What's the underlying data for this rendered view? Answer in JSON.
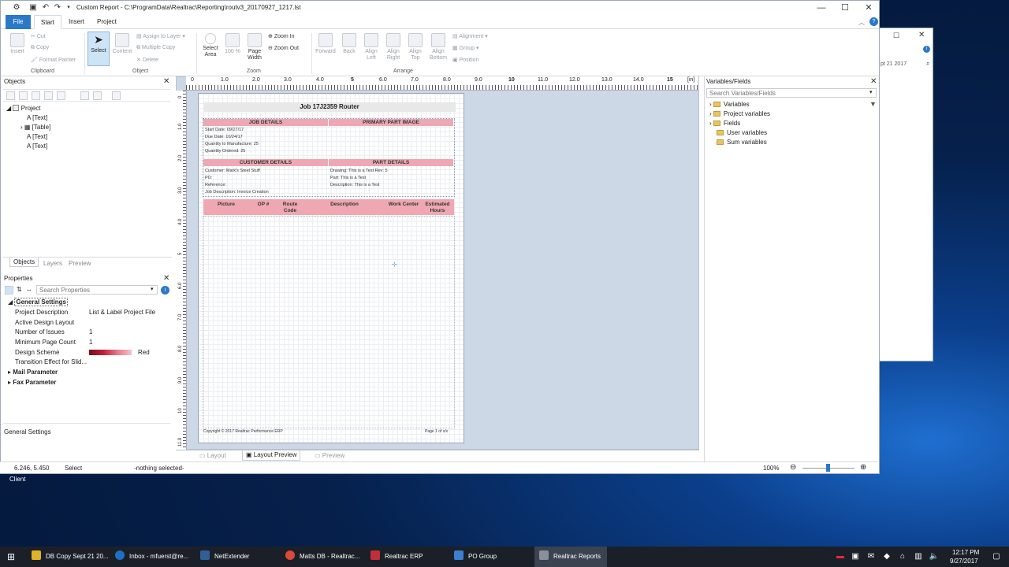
{
  "window": {
    "title": "Custom Report - C:\\ProgramData\\Realtrac\\Reporting\\routv3_20170927_1217.lst"
  },
  "tabs": [
    "File",
    "Start",
    "Insert",
    "Project"
  ],
  "ribbon": {
    "clipboard": {
      "insert": "Insert",
      "cut": "Cut",
      "copy": "Copy",
      "format_painter": "Format Painter",
      "label": "Clipboard"
    },
    "object": {
      "select": "Select",
      "content": "Content",
      "assign_layer": "Assign to Layer",
      "multiple_copy": "Multiple Copy",
      "delete": "Delete",
      "label": "Object"
    },
    "zoom": {
      "select_area": "Select Area",
      "hundred": "100 %",
      "page_width": "Page Width",
      "zoom_in": "Zoom In",
      "zoom_out": "Zoom Out",
      "label": "Zoom"
    },
    "arrange": {
      "forward": "Forward",
      "back": "Back",
      "align_left": "Align Left",
      "align_right": "Align Right",
      "align_top": "Align Top",
      "align_bottom": "Align Bottom",
      "alignment": "Alignment",
      "group": "Group",
      "position": "Position",
      "label": "Arrange"
    }
  },
  "objects_panel": {
    "title": "Objects",
    "tree": [
      "Project",
      "[Text]",
      "[Table]",
      "[Text]",
      "[Text]"
    ],
    "tabs": [
      "Objects",
      "Layers",
      "Preview"
    ]
  },
  "properties_panel": {
    "title": "Properties",
    "search_placeholder": "Search Properties",
    "general": "General Settings",
    "rows": [
      {
        "name": "Project Description",
        "value": "List & Label Project File"
      },
      {
        "name": "Active Design Layout",
        "value": ""
      },
      {
        "name": "Number of Issues",
        "value": "1"
      },
      {
        "name": "Minimum Page Count",
        "value": "1"
      },
      {
        "name": "Design Scheme",
        "value": "Red"
      },
      {
        "name": "Transition Effect for Slid...",
        "value": ""
      }
    ],
    "mail": "Mail Parameter",
    "fax": "Fax Parameter",
    "footer": "General Settings"
  },
  "ruler": {
    "top": [
      "0",
      "1.0",
      "2.0",
      "3.0",
      "4.0",
      "5",
      "6.0",
      "7.0",
      "8.0",
      "9.0",
      "10",
      "11.0",
      "12.0",
      "13.0",
      "14.0",
      "15",
      "[in]"
    ],
    "left": [
      "0",
      "1.0",
      "2.0",
      "3.0",
      "4.0",
      "5",
      "6.0",
      "7.0",
      "8.0",
      "9.0",
      "10",
      "11.0"
    ]
  },
  "report": {
    "title": "Job 17J2359 Router",
    "job_details": "JOB DETAILS",
    "primary_part_image": "PRIMARY PART IMAGE",
    "start_date": "Start Date: 09/27/17",
    "due_date": "Due Date: 10/24/17",
    "qty_manufacture": "Quantity to Manufacture: 25",
    "qty_ordered": "Quantity Ordered: 25",
    "customer_details": "CUSTOMER DETAILS",
    "part_details": "PART DETAILS",
    "customer": "Customer: Mark's Steel Stuff",
    "po": "PO:",
    "reference": "Reference:",
    "job_description": "Job Description: Invoice Creation",
    "drawing": "Drawing: This is a Test Rev: 5",
    "part": "Part: This is a Test",
    "description": "Description: This is a Test",
    "columns": [
      "Picture",
      "OP #",
      "Route Code",
      "Description",
      "Work Center",
      "Estimated Hours"
    ],
    "footer_left": "Copyright © 2017 Realtrac Performance ERP",
    "footer_right": "Page 1 of x/x"
  },
  "view_tabs": [
    "Layout",
    "Layout Preview",
    "Preview"
  ],
  "variables_panel": {
    "title": "Variables/Fields",
    "search_placeholder": "Search Variables/Fields",
    "items": [
      "Variables",
      "Project variables",
      "Fields",
      "User variables",
      "Sum variables"
    ]
  },
  "status": {
    "coords": "6.246, 5.450",
    "mode": "Select",
    "selection": "-nothing selected-",
    "zoom": "100%"
  },
  "client_label": "Client",
  "taskbar": {
    "items": [
      "DB Copy Sept 21 20...",
      "Inbox - mfuerst@re...",
      "NetExtender",
      "Matts DB - Realtrac...",
      "Realtrac ERP",
      "PO Group",
      "Realtrac Reports"
    ],
    "time": "12:17 PM",
    "date": "9/27/2017"
  },
  "background_window": {
    "text": "pt 21 2017"
  }
}
